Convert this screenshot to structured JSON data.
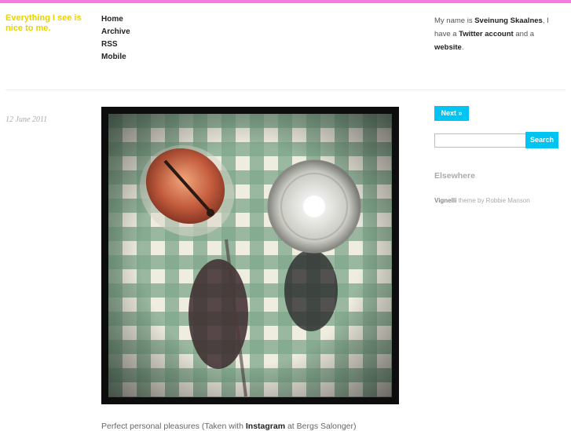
{
  "colors": {
    "accent_pink": "#f57adf",
    "title_yellow": "#e8d200",
    "button_cyan": "#00c5f2"
  },
  "header": {
    "blog_title": "Everything I see is nice to me.",
    "nav": [
      "Home",
      "Archive",
      "RSS",
      "Mobile"
    ]
  },
  "bio": {
    "prefix": "My name is",
    "name": "Sveinung Skaalnes",
    "mid1": ", I have a",
    "twitter": "Twitter account",
    "mid2": "and a",
    "website": "website",
    "suffix": "."
  },
  "post": {
    "date": "12 June 2011",
    "caption_prefix": "Perfect personal pleasures (Taken with",
    "caption_link": "Instagram",
    "caption_suffix": "at Bergs Salonger)"
  },
  "sidebar": {
    "next_label": "Next »",
    "search_placeholder": "",
    "search_button": "Search",
    "elsewhere_heading": "Elsewhere",
    "credit_theme": "Vignelli",
    "credit_mid": "theme by Robbie Manson"
  }
}
